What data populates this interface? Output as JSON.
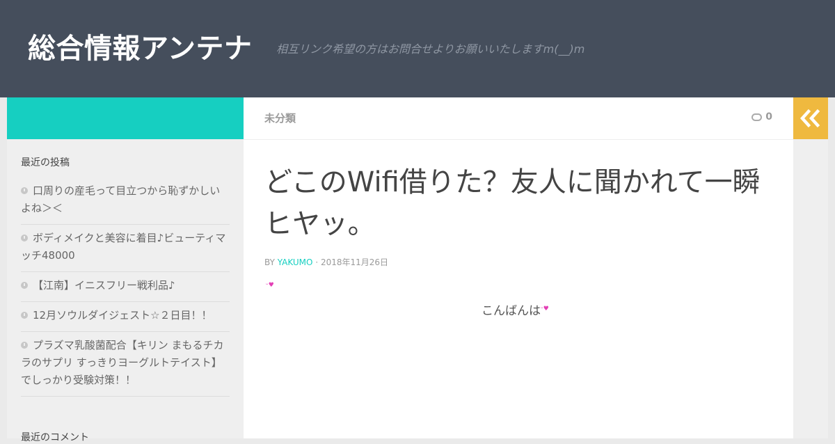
{
  "header": {
    "site_title": "総合情報アンテナ",
    "site_description": "相互リンク希望の方はお問合せよりお願いいたしますm(__)m"
  },
  "sidebar": {
    "recent_posts_heading": "最近の投稿",
    "recent_posts": [
      "口周りの産毛って目立つから恥ずかしいよね＞＜",
      "ボディメイクと美容に着目♪ビューティマッチ48000",
      "【江南】イニスフリー戦利品♪",
      "12月ソウルダイジェスト☆２日目！！",
      "プラズマ乳酸菌配合【キリン まもるチカラのサプリ すっきりヨーグルトテイスト】でしっかり受験対策！！"
    ],
    "recent_comments_heading": "最近のコメント"
  },
  "post": {
    "category": "未分類",
    "comment_count": "0",
    "title": "どこのWifi借りた？友人に聞かれて一瞬ヒヤッ。",
    "by_label": "BY",
    "author": "YAKUMO",
    "separator": "·",
    "date": "2018年11月26日",
    "greeting": "こんばんは"
  },
  "icons": {
    "toggle": "double-chevron-left-icon",
    "comment": "speech-bubble-icon",
    "post_bullet": "clock-icon",
    "emoji": "heart-emoji"
  },
  "colors": {
    "header_bg": "#454e5c",
    "accent_teal": "#16cfc1",
    "accent_yellow": "#efb93f",
    "emoji_pink": "#e33fb5"
  }
}
